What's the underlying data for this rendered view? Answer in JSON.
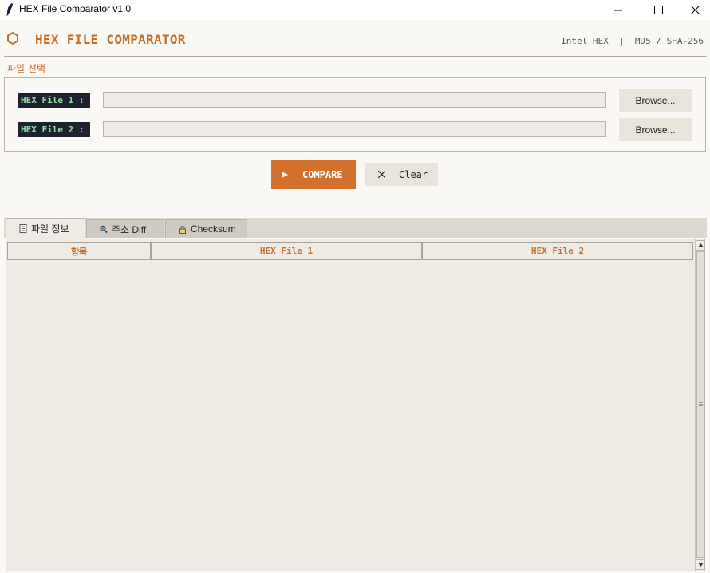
{
  "window": {
    "title": "HEX File Comparator  v1.0",
    "controls": [
      "minimize",
      "maximize",
      "close"
    ]
  },
  "header": {
    "title": "HEX FILE COMPARATOR",
    "meta": "Intel HEX  |  MD5 / SHA-256",
    "accent_color": "#c46e2a"
  },
  "file_section": {
    "label": "파일 선택",
    "files": [
      {
        "label": "HEX File 1 :",
        "value": "",
        "browse_label": "Browse..."
      },
      {
        "label": "HEX File 2 :",
        "value": "",
        "browse_label": "Browse..."
      }
    ]
  },
  "actions": {
    "compare_label": "COMPARE",
    "compare_icon": "play-icon",
    "compare_color": "#d4702e",
    "clear_label": "Clear",
    "clear_icon": "x-icon"
  },
  "tabs": [
    {
      "label": "파일 정보",
      "icon": "document-icon",
      "active": true
    },
    {
      "label": "주소 Diff",
      "icon": "magnifier-icon",
      "active": false
    },
    {
      "label": "Checksum",
      "icon": "lock-icon",
      "active": false
    }
  ],
  "table": {
    "columns": [
      "항목",
      "HEX File 1",
      "HEX File 2"
    ],
    "rows": []
  }
}
